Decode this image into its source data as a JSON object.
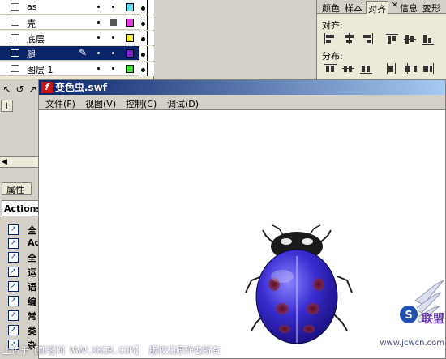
{
  "timeline": {
    "layers": [
      {
        "name": "as",
        "swatch": "#5fe0f0",
        "locked": false,
        "selected": false
      },
      {
        "name": "壳",
        "swatch": "#e040e0",
        "locked": true,
        "selected": false
      },
      {
        "name": "底层",
        "swatch": "#f0f040",
        "locked": false,
        "selected": false
      },
      {
        "name": "腿",
        "swatch": "#7a1fd0",
        "locked": false,
        "selected": true
      },
      {
        "name": "图层 1",
        "swatch": "#40e040",
        "locked": false,
        "selected": false
      }
    ]
  },
  "align_panel": {
    "tabs": [
      "颜色",
      "样本",
      "对齐",
      "信息",
      "变形"
    ],
    "active_tab": "对齐",
    "close_glyph": "✕",
    "align_label": "对齐:",
    "distribute_label": "分布:"
  },
  "left_panel": {
    "properties_tab": "属性",
    "actions_field": "Actions",
    "action_items": [
      "全",
      "Ac",
      "全",
      "运",
      "语",
      "编",
      "常",
      "类",
      "杂"
    ]
  },
  "player": {
    "title": "变色虫.swf",
    "icon_glyph": "f",
    "menu": [
      "文件(F)",
      "视图(V)",
      "控制(C)",
      "调试(D)"
    ]
  },
  "footer": {
    "text": "上传于【新客网 WWW.XKER.COM】 版权归原作者所有"
  },
  "watermark": {
    "brand": "联盟",
    "url": "www.jcwcn.com"
  },
  "colors": {
    "selection": "#0a246a",
    "ladybug_shell": "#2a1fa0",
    "ladybug_spots": "#7a1a2a"
  }
}
